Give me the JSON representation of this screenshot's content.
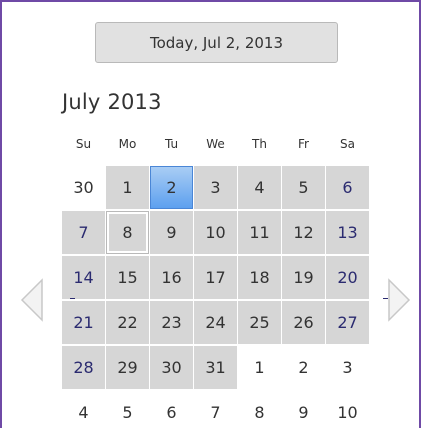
{
  "today_button": {
    "label": "Today, Jul 2, 2013"
  },
  "month_title": "July 2013",
  "weekdays": [
    "Su",
    "Mo",
    "Tu",
    "We",
    "Th",
    "Fr",
    "Sa"
  ],
  "weeks": [
    [
      {
        "d": "30",
        "c": false
      },
      {
        "d": "1",
        "c": true
      },
      {
        "d": "2",
        "c": true,
        "sel": true
      },
      {
        "d": "3",
        "c": true
      },
      {
        "d": "4",
        "c": true
      },
      {
        "d": "5",
        "c": true
      },
      {
        "d": "6",
        "c": true
      }
    ],
    [
      {
        "d": "7",
        "c": true
      },
      {
        "d": "8",
        "c": true,
        "today": true
      },
      {
        "d": "9",
        "c": true
      },
      {
        "d": "10",
        "c": true
      },
      {
        "d": "11",
        "c": true
      },
      {
        "d": "12",
        "c": true
      },
      {
        "d": "13",
        "c": true
      }
    ],
    [
      {
        "d": "14",
        "c": true
      },
      {
        "d": "15",
        "c": true
      },
      {
        "d": "16",
        "c": true
      },
      {
        "d": "17",
        "c": true
      },
      {
        "d": "18",
        "c": true
      },
      {
        "d": "19",
        "c": true
      },
      {
        "d": "20",
        "c": true
      }
    ],
    [
      {
        "d": "21",
        "c": true
      },
      {
        "d": "22",
        "c": true
      },
      {
        "d": "23",
        "c": true
      },
      {
        "d": "24",
        "c": true
      },
      {
        "d": "25",
        "c": true
      },
      {
        "d": "26",
        "c": true
      },
      {
        "d": "27",
        "c": true
      }
    ],
    [
      {
        "d": "28",
        "c": true
      },
      {
        "d": "29",
        "c": true
      },
      {
        "d": "30",
        "c": true
      },
      {
        "d": "31",
        "c": true
      },
      {
        "d": "1",
        "c": false
      },
      {
        "d": "2",
        "c": false
      },
      {
        "d": "3",
        "c": false
      }
    ],
    [
      {
        "d": "4",
        "c": false
      },
      {
        "d": "5",
        "c": false
      },
      {
        "d": "6",
        "c": false
      },
      {
        "d": "7",
        "c": false
      },
      {
        "d": "8",
        "c": false
      },
      {
        "d": "9",
        "c": false
      },
      {
        "d": "10",
        "c": false
      }
    ]
  ],
  "nav": {
    "prev_icon": "chevron-left-icon",
    "next_icon": "chevron-right-icon"
  },
  "colors": {
    "frame": "#6f4aa6",
    "cell_bg": "#d6d6d6",
    "weekend_text": "#2b2b70",
    "selected_top": "#a9cdf4",
    "selected_bottom": "#5da0ef"
  }
}
